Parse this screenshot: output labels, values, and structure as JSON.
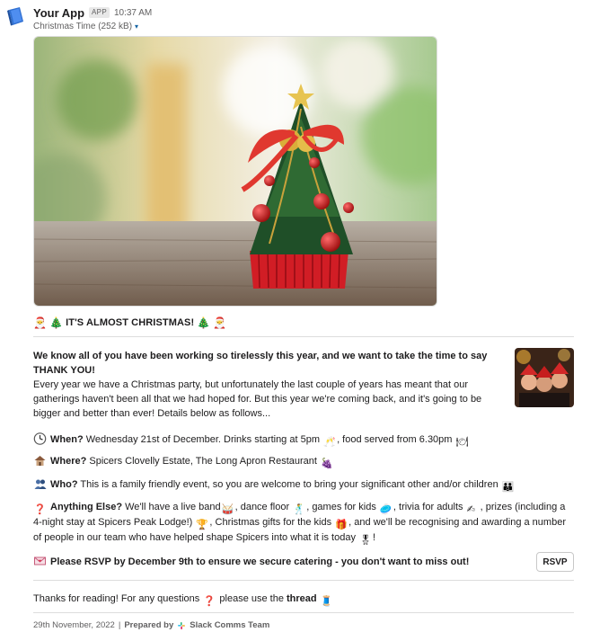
{
  "app": {
    "name": "Your App",
    "badge": "APP",
    "time": "10:37 AM"
  },
  "file": {
    "name": "Christmas Time (252 kB)",
    "caret": "▾"
  },
  "headline": {
    "text": "IT'S ALMOST CHRISTMAS!",
    "left_emoji": [
      "santa",
      "christmas-tree"
    ],
    "right_emoji": [
      "christmas-tree",
      "santa"
    ]
  },
  "intro": {
    "bold": "We know all of you have been working so tirelessly this year, and we want to take the time to say THANK YOU!",
    "body": "Every year we have a Christmas party, but unfortunately the last couple of years has meant that our gatherings haven't been all that we had hoped for. But this year we're coming back, and it's going to be bigger and better than ever! Details below as follows..."
  },
  "when": {
    "label": "When?",
    "text1": "Wednesday 21st of December. Drinks starting at 5pm",
    "text2": ", food served from 6.30pm"
  },
  "where": {
    "label": "Where?",
    "text": "Spicers Clovelly Estate, The Long Apron Restaurant"
  },
  "who": {
    "label": "Who?",
    "text": "This is a family friendly event, so you are welcome to bring your significant other and/or children"
  },
  "anything": {
    "label": "Anything Else?",
    "t1": "We'll have a live band",
    "t2": ", dance floor",
    "t3": ", games for kids",
    "t4": ", trivia for adults",
    "t5": ", prizes (including a 4-night stay at Spicers Peak Lodge!)",
    "t6": ", Christmas gifts for the kids",
    "t7": ", and we'll be recognising and awarding a number of people in our team who have helped shape Spicers into what it is today",
    "t8": "!"
  },
  "rsvp": {
    "text": "Please RSVP by December 9th to ensure we secure catering - you don't want to miss out!",
    "button": "RSVP"
  },
  "thanks": {
    "t1": "Thanks for reading! For any questions",
    "t2": "please use the",
    "thread": "thread"
  },
  "footer": {
    "date": "29th November, 2022",
    "sep": "|",
    "prepared": "Prepared by",
    "team": "Slack Comms Team"
  },
  "colors": {
    "muted": "#616061",
    "divider": "#dddddd",
    "link": "#1264a3"
  }
}
